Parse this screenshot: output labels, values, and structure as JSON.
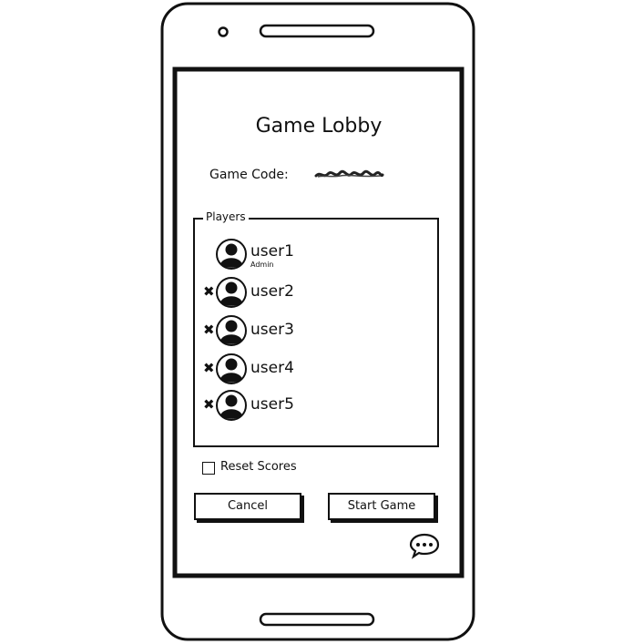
{
  "screen": {
    "title": "Game Lobby",
    "game_code_label": "Game Code:",
    "players_legend": "Players"
  },
  "players": [
    {
      "name": "user1",
      "role": "Admin",
      "removable": false
    },
    {
      "name": "user2",
      "removable": true
    },
    {
      "name": "user3",
      "removable": true
    },
    {
      "name": "user4",
      "removable": true
    },
    {
      "name": "user5",
      "removable": true
    }
  ],
  "remove_glyph": "✖",
  "options": {
    "reset_scores_label": "Reset Scores",
    "reset_scores_checked": false
  },
  "buttons": {
    "cancel_label": "Cancel",
    "start_label": "Start Game"
  },
  "icons": {
    "avatar": "user-avatar-icon",
    "chat": "chat-bubble-icon",
    "camera": "front-camera-icon"
  }
}
